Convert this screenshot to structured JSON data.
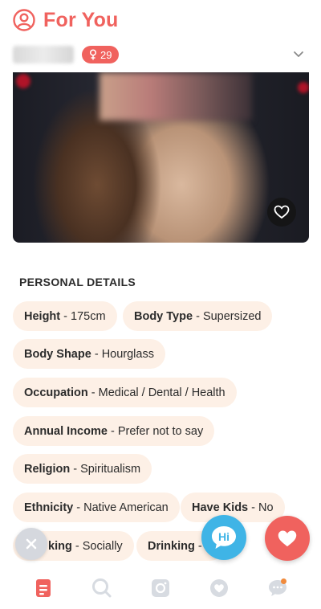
{
  "header": {
    "title": "For You",
    "icon": "user-circle-icon"
  },
  "profile": {
    "age": "29",
    "gender_icon": "female-icon"
  },
  "colors": {
    "accent": "#f0625e",
    "chip_bg": "#fdf0e6",
    "hi_blue": "#3fb4e6"
  },
  "personal_details": {
    "title": "PERSONAL DETAILS",
    "chips": [
      {
        "key": "Height",
        "value": "175cm"
      },
      {
        "key": "Body Type",
        "value": "Supersized"
      },
      {
        "key": "Body Shape",
        "value": "Hourglass"
      },
      {
        "key": "Occupation",
        "value": "Medical / Dental / Health"
      },
      {
        "key": "Annual Income",
        "value": "Prefer not to say"
      },
      {
        "key": "Religion",
        "value": "Spiritualism"
      },
      {
        "key": "Ethnicity",
        "value": "Native American"
      },
      {
        "key": "Have Kids",
        "value": "No"
      },
      {
        "key": "king",
        "value": "Socially"
      },
      {
        "key": "Drinking",
        "value": "S"
      }
    ]
  },
  "actions": {
    "hi_label": "Hi"
  },
  "nav": [
    "profile-icon",
    "search-icon",
    "instagram-icon",
    "heart-icon",
    "chat-icon"
  ]
}
